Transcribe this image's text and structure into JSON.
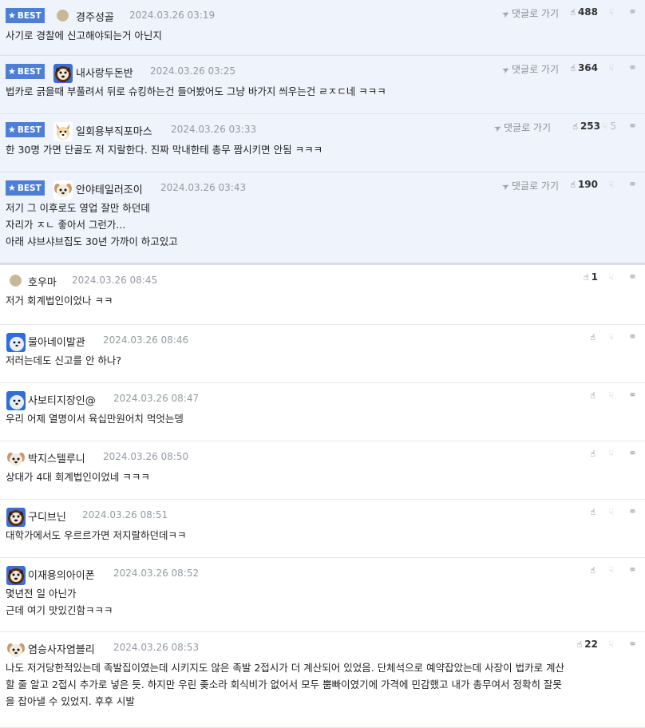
{
  "best_badge": "BEST",
  "comments": [
    {
      "best": true,
      "avatar": "dot",
      "nick": "경주성골",
      "date": "2024.03.26 03:19",
      "reply_label": "댓글로 가기",
      "likes": "488",
      "dislikes": "",
      "lines": [
        "사기로 경찰에 신고해야되는거 아닌지"
      ]
    },
    {
      "best": true,
      "avatar": "dog",
      "nick": "내사랑두돈반",
      "date": "2024.03.26 03:25",
      "reply_label": "댓글로 가기",
      "likes": "364",
      "dislikes": "",
      "lines": [
        "법카로 긁을때 부풀려서 뒤로 슈킹하는건 들어봤어도 그냥 바가지 씌우는건 ㄹㅈㄷ네 ㅋㅋㅋ"
      ]
    },
    {
      "best": true,
      "avatar": "corgi",
      "nick": "일회용부직포마스",
      "date": "2024.03.26 03:33",
      "reply_label": "댓글로 가기",
      "likes": "253",
      "dislikes": "5",
      "lines": [
        "한 30명 가면 단골도 저 지랄한다. 진짜 막내한테 총무 짬시키면 안됨 ㅋㅋㅋ"
      ]
    },
    {
      "best": true,
      "avatar": "puppy",
      "nick": "안야테일러조이",
      "date": "2024.03.26 03:43",
      "reply_label": "댓글로 가기",
      "likes": "190",
      "dislikes": "",
      "lines": [
        "저기 그 이후로도 영업 잘만 하던데",
        "자리가 ㅈㄴ 좋아서 그런가...",
        "아래 샤브샤브집도 30년 가까이 하고있고"
      ]
    },
    {
      "best": false,
      "avatar": "dot",
      "nick": "호우마",
      "date": "2024.03.26 08:45",
      "likes": "1",
      "dislikes": "",
      "lines": [
        "저거 회계법인이었나 ㅋㅋ"
      ]
    },
    {
      "best": false,
      "avatar": "blue",
      "nick": "물아네이발관",
      "date": "2024.03.26 08:46",
      "likes": "",
      "dislikes": "",
      "lines": [
        "저러는데도 신고를 안 하나?"
      ]
    },
    {
      "best": false,
      "avatar": "blue",
      "nick": "사보티지장인@",
      "date": "2024.03.26 08:47",
      "likes": "",
      "dislikes": "",
      "lines": [
        "우리 어제 열명이서 육십만원어치 먹엇는뎅"
      ]
    },
    {
      "best": false,
      "avatar": "puppy",
      "nick": "박지스텔루니",
      "date": "2024.03.26 08:50",
      "likes": "",
      "dislikes": "",
      "lines": [
        "상대가 4대 회계법인이었네 ㅋㅋㅋ"
      ]
    },
    {
      "best": false,
      "avatar": "dog",
      "nick": "구디브닌",
      "date": "2024.03.26 08:51",
      "likes": "",
      "dislikes": "",
      "lines": [
        "대학가에서도 우르르가면 저지랄하던데ㅋㅋ"
      ]
    },
    {
      "best": false,
      "avatar": "dog",
      "nick": "이재용의아이폰",
      "date": "2024.03.26 08:52",
      "likes": "",
      "dislikes": "",
      "lines": [
        "몇년전 일 아닌가",
        "근데 여기 맛있긴함ㅋㅋㅋ"
      ]
    },
    {
      "best": false,
      "avatar": "puppy",
      "nick": "염승사자염블리",
      "date": "2024.03.26 08:53",
      "likes": "22",
      "dislikes": "",
      "lines": [
        "나도 저거당한적있는데 족발집이였는데 시키지도 않은 족발 2접시가 더 계산되어 있었음. 단체석으로 예약잡았는데 사장이 법카로 계산",
        "할 줄 알고 2접시 추가로 넣은 듯. 하지만 우린 좆소라 회식비가 없어서 모두 뿜빠이였기에 가격에 민감했고 내가 총무여서 정확히 잘못",
        "을 잡아낼 수 있었지. 후후 시발"
      ]
    }
  ]
}
